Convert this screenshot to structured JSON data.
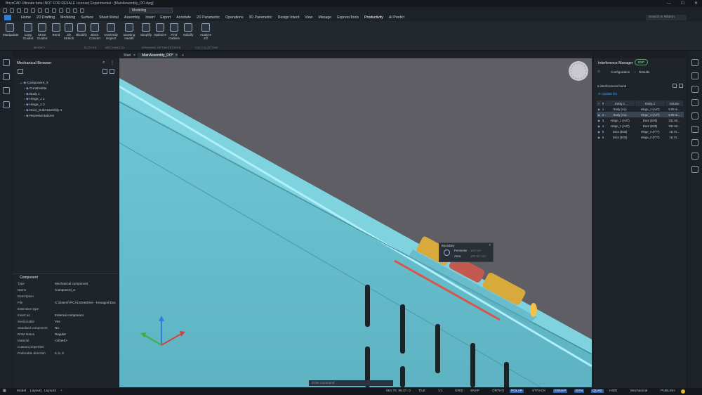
{
  "window": {
    "title": "BricsCAD Ultimate beta (NOT FOR RESALE License) Experimental - [MainAssembly_DO.dwg]"
  },
  "quick_access": {
    "workspace": "Modeling"
  },
  "menu": {
    "tabs": [
      "Home",
      "2D Drafting",
      "Modeling",
      "Surface",
      "Sheet Metal",
      "Assembly",
      "Insert",
      "Export",
      "Annotate",
      "2D Parametric",
      "Operations",
      "3D Parametric",
      "Design Intent",
      "View",
      "Manage",
      "ExpressTools",
      "Productivity",
      "AI Predict"
    ],
    "active": "Productivity",
    "search_placeholder": "Search in Ribbon"
  },
  "ribbon": {
    "buttons": [
      "Manipulate",
      "Copy Guided",
      "Move Guided",
      "Bend",
      "3D Stretch",
      "Blockify",
      "Block Convert",
      "Assembly Inspect",
      "Drawing Health",
      "Simplify",
      "Optimize",
      "Find Outliers",
      "Solidify",
      "Analyze 2D"
    ],
    "groups": [
      "MODIFY",
      "BLOCKS",
      "MECHANICAL",
      "DRAWING OPTIMIZATIONS",
      "CALCULATIONS"
    ]
  },
  "doc_tabs": {
    "start": "Start",
    "active": "MainAssembly_DO*",
    "add": "+"
  },
  "browser": {
    "title": "Mechanical Browser",
    "tree": [
      "Component_3",
      "Constraints",
      "Body 1",
      "Hinge_1 1",
      "Hinge_1 2",
      "Door_SubAssembly 1",
      "Representations"
    ]
  },
  "properties": {
    "header": "Component",
    "rows": [
      {
        "k": "Type",
        "v": "Mechanical component"
      },
      {
        "k": "Name",
        "v": "Component_3"
      },
      {
        "k": "Description",
        "v": ""
      },
      {
        "k": "File",
        "v": "C:\\Users\\YPCAL\\OneDrive - Hexagon\\Doc"
      },
      {
        "k": "Extension type",
        "v": ""
      },
      {
        "k": "Insert as",
        "v": "External component"
      },
      {
        "k": "Sectionable",
        "v": "Yes"
      },
      {
        "k": "Standard component",
        "v": "No"
      },
      {
        "k": "BOM status",
        "v": "Regular"
      },
      {
        "k": "Material",
        "v": "<inherit>"
      },
      {
        "k": "Custom properties",
        "v": ""
      },
      {
        "k": "Preferable direction",
        "v": "0, 0, 0"
      }
    ]
  },
  "boundary_popup": {
    "title": "Boundary",
    "perimeter_label": "Perimeter",
    "perimeter_value": "183 mm",
    "area_label": "Area",
    "area_value": "152.30 mm²"
  },
  "command_line": {
    "placeholder": "Enter command"
  },
  "interference": {
    "title": "Interference Manager",
    "badge": "EXP",
    "breadcrumb": [
      "Configuration",
      "Results"
    ],
    "count": "6 interferences found",
    "update": "Update list",
    "columns": [
      "#",
      "Entity 1",
      "Entity 2",
      "Volume"
    ],
    "rows": [
      [
        "1",
        "Body (A1)",
        "Hinge_1 (A47)",
        "6.99 m..."
      ],
      [
        "2",
        "Body (A1)",
        "Hinge_1 (A47)",
        "6.99 m..."
      ],
      [
        "3",
        "Hinge_1 (A47)",
        "Door (E05)",
        "331.50..."
      ],
      [
        "4",
        "Hinge_1 (A47)",
        "Door (E05)",
        "331.50..."
      ],
      [
        "5",
        "Door (E05)",
        "Hinge_2 (F77)",
        "16.74..."
      ],
      [
        "6",
        "Door (E05)",
        "Hinge_2 (F77)",
        "16.74..."
      ]
    ],
    "selected_row": 2
  },
  "status": {
    "layouts": [
      "Model",
      "Layout1",
      "Layout2"
    ],
    "coords": "554.79, 98.37, 0",
    "toggles": [
      "TILE",
      "1:1",
      "GRID",
      "SNAP",
      "ORTHO",
      "POLAR",
      "STRACK",
      "ESNAP",
      "DYN",
      "QUAD",
      "HIDE"
    ],
    "active_toggles": [
      "POLAR",
      "ESNAP",
      "DYN",
      "QUAD"
    ],
    "workspace": "Mechanical",
    "publish": "PUBLISH"
  },
  "colors": {
    "accent": "#4aa3ff",
    "model_teal": "#67c5d4",
    "hinge_yellow": "#d8a93b",
    "interference_red": "#c45a4f"
  }
}
